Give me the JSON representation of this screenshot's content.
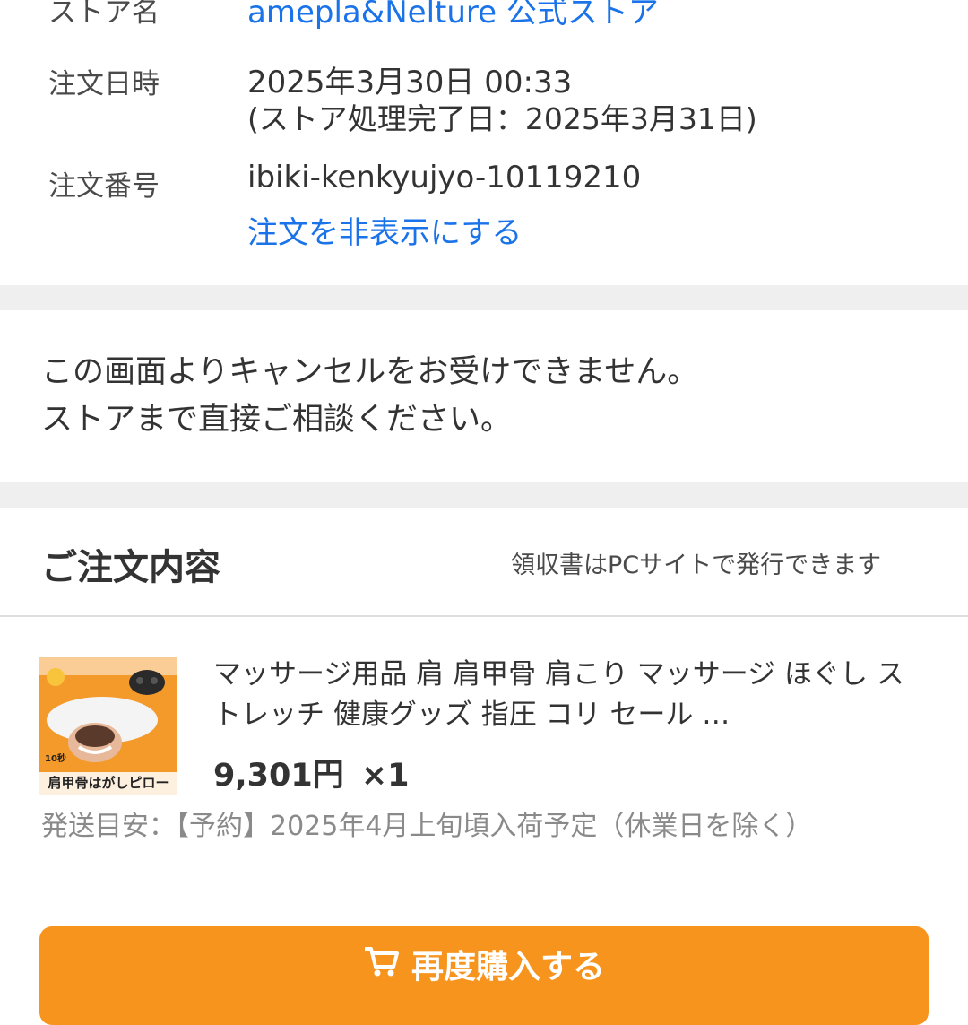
{
  "order_info": {
    "store_label": "ストア名",
    "store_name": "amepla&Nelture 公式ストア",
    "date_label": "注文日時",
    "date_value": "2025年3月30日 00:33",
    "processed_note": "(ストア処理完了日：2025年3月31日)",
    "number_label": "注文番号",
    "number_value": "ibiki-kenkyujyo-10119210",
    "hide_link": "注文を非表示にする"
  },
  "notice": {
    "line1": "この画面よりキャンセルをお受けできません。",
    "line2": "ストアまで直接ご相談ください。"
  },
  "order_contents": {
    "heading": "ご注文内容",
    "receipt_note": "領収書はPCサイトで発行できます"
  },
  "item": {
    "thumbnail_caption": "肩甲骨はがしピロー",
    "thumbnail_badge": "10秒",
    "name": "マッサージ用品 肩 肩甲骨 肩こり マッサージ ほぐし ストレッチ 健康グッズ 指圧 コリ セール …",
    "price": "9,301円",
    "quantity": "×1",
    "shipping_label": "発送目安：",
    "shipping_value": "【予約】2025年4月上旬頃入荷予定（休業日を除く）"
  },
  "buy_again_button": {
    "icon": "cart-icon",
    "label": "再度購入する"
  },
  "colors": {
    "link": "#1a73e8",
    "section_gap": "#efefef",
    "button": "#f7941d"
  }
}
